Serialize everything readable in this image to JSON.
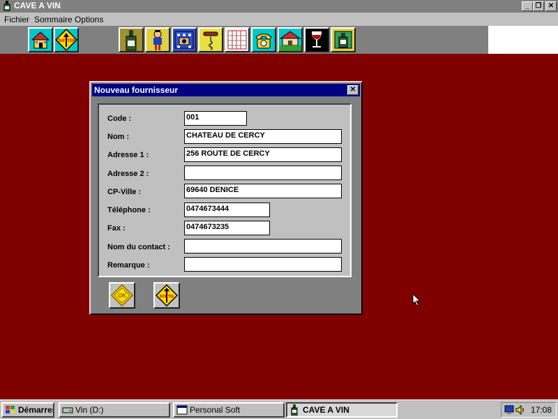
{
  "window": {
    "title": "CAVE A VIN",
    "minimize": "_",
    "restore": "❐",
    "close": "✕"
  },
  "menu": [
    "Fichier",
    "Sommaire",
    "Options"
  ],
  "toolbar": {
    "home_label": "",
    "quit_label": "QUITTER"
  },
  "dialog": {
    "title": "Nouveau fournisseur",
    "close": "✕",
    "fields": {
      "code": {
        "label": "Code :",
        "value": "001"
      },
      "nom": {
        "label": "Nom :",
        "value": "CHATEAU DE CERCY"
      },
      "adresse1": {
        "label": "Adresse 1 :",
        "value": "256 ROUTE DE CERCY"
      },
      "adresse2": {
        "label": "Adresse 2 :",
        "value": ""
      },
      "cpville": {
        "label": "CP-Ville :",
        "value": "69640 DENICE"
      },
      "telephone": {
        "label": "Téléphone :",
        "value": "0474673444"
      },
      "fax": {
        "label": "Fax :",
        "value": "0474673235"
      },
      "contact": {
        "label": "Nom du  contact :",
        "value": ""
      },
      "remarque": {
        "label": "Remarque :",
        "value": ""
      }
    },
    "ok_label": "OK",
    "sortie_label": "SORTIE"
  },
  "taskbar": {
    "start": "Démarrer",
    "tasks": [
      "Vin (D:)",
      "Personal Soft",
      "CAVE A VIN"
    ],
    "clock": "17:08"
  },
  "colors": {
    "desktop": "#800000",
    "dialog_title": "#000080",
    "face": "#c0c0c0"
  }
}
